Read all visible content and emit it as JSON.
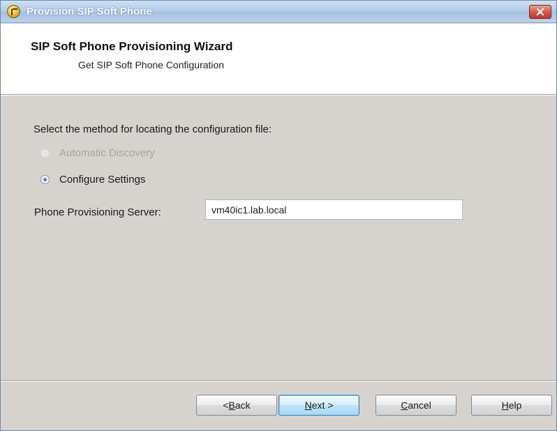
{
  "window": {
    "title": "Provision SIP Soft Phone"
  },
  "header": {
    "title": "SIP Soft Phone Provisioning Wizard",
    "subtitle": "Get SIP Soft Phone Configuration"
  },
  "content": {
    "prompt": "Select the method for locating the configuration file:",
    "options": [
      {
        "label": "Automatic Discovery",
        "selected": false,
        "enabled": false
      },
      {
        "label": "Configure Settings",
        "selected": true,
        "enabled": true
      }
    ],
    "server_label": "Phone Provisioning Server:",
    "server_value": "vm40ic1.lab.local"
  },
  "buttons": {
    "back": {
      "pre": "< ",
      "mnemonic": "B",
      "rest": "ack"
    },
    "next": {
      "pre": "",
      "mnemonic": "N",
      "rest": "ext >"
    },
    "cancel": {
      "pre": "",
      "mnemonic": "C",
      "rest": "ancel"
    },
    "help": {
      "pre": "",
      "mnemonic": "H",
      "rest": "elp"
    }
  },
  "colors": {
    "title_bar": "#b5cde9",
    "dialog_background": "#d6d3ce",
    "close_button": "#c0392b",
    "default_button_border": "#3c7fb1"
  },
  "icons": {
    "title": "phone-app-icon",
    "close": "close-icon"
  }
}
